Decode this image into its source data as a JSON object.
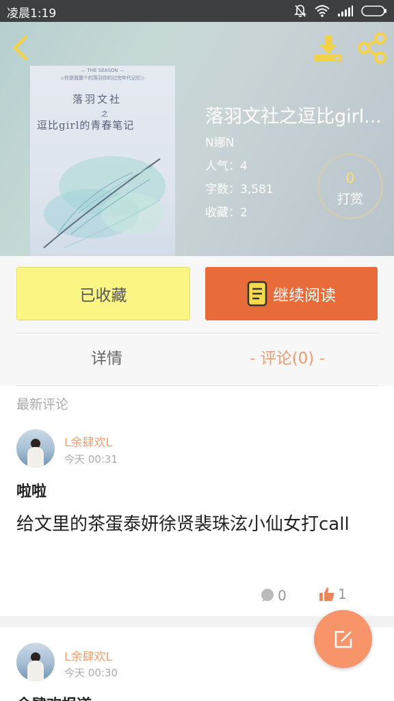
{
  "status_bar": {
    "time": "凌晨1:19",
    "icons": [
      "mute-bell-icon",
      "wifi-icon",
      "signal-icon",
      "battery-icon"
    ]
  },
  "top_bar": {
    "icons": [
      "back-arrow-icon",
      "download-icon",
      "share-icon"
    ]
  },
  "book": {
    "cover": {
      "top_text": "— THE SEASON —",
      "sub_text": "◇你是我整个的落羽你的过完年代记忆◇",
      "line1": "落羽文社",
      "line2": "之",
      "line3": "逗比girl的青春笔记"
    },
    "title": "落羽文社之逗比girl...",
    "author": "N娜N",
    "popularity": "人气：4",
    "word_count": "字数：3,581",
    "favorites": "收藏：2",
    "reward": {
      "count": "0",
      "label": "打赏"
    }
  },
  "actions": {
    "collected_label": "已收藏",
    "continue_read_label": "继续阅读"
  },
  "tabs": {
    "detail": "详情",
    "comments": "- 评论(0) -",
    "active": "comments"
  },
  "comments_section": {
    "title": "最新评论",
    "items": [
      {
        "username": "L余肆欢L",
        "time": "今天 00:31",
        "heading": "啦啦",
        "body": "给文里的茶蛋泰妍徐贤裴珠泫小仙女打call",
        "reply_count": "0",
        "like_count": "1"
      },
      {
        "username": "L余肆欢L",
        "time": "今天 00:30",
        "heading": "余肆欢报道"
      }
    ]
  },
  "colors": {
    "accent_orange": "#e86b3a",
    "collected_yellow": "#fbf584",
    "fab_orange": "#f7946a",
    "username_orange": "#f0a070",
    "reward_yellow": "#f4e06a"
  },
  "fab": {
    "icon": "edit-icon"
  }
}
